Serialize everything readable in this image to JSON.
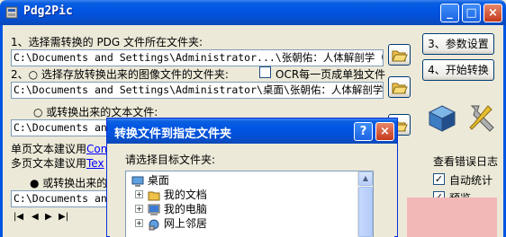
{
  "window": {
    "title": "Pdg2Pic",
    "minimize": "_",
    "maximize": "□",
    "close": "×"
  },
  "step1": {
    "label": "1、选择需转换的 PDG 文件所在文件夹:",
    "path": "C:\\Documents and Settings\\Administrator...\\张朝佑：人体解剖学（第二版）"
  },
  "step2": {
    "label": "2、○ 选择存放转换出来的图像文件的文件夹:",
    "ocr_label": "OCR每一页成单独文件",
    "path": "C:\\Documents and Settings\\Administrator\\桌面\\张朝佑：人体解剖学（第二"
  },
  "step3": {
    "label": "○ 或转换出来的文本文件:",
    "path": "C:\\Documents and Se",
    "single_text": "单页文本建议用",
    "single_link": "Com",
    "multi_text": "多页文本建议用",
    "multi_link": "Tex",
    "radio_label": "● 或转换出来的",
    "path2": "C:\\Documents and S"
  },
  "buttons": {
    "settings": "3、参数设置",
    "start": "4、开始转换"
  },
  "log": {
    "title": "查看错误日志",
    "auto_stats": "自动统计",
    "preview": "预览"
  },
  "dialog": {
    "title": "转换文件到指定文件夹",
    "help": "?",
    "close": "×",
    "prompt": "请选择目标文件夹:",
    "tree": [
      {
        "label": "桌面"
      },
      {
        "label": "我的文档"
      },
      {
        "label": "我的电脑"
      },
      {
        "label": "网上邻居"
      }
    ]
  },
  "media": {
    "buttons": [
      "|◀",
      "◀",
      "▶",
      "▶|"
    ]
  },
  "colors": {
    "titlebar": "#0054E3",
    "face": "#ECE9D8",
    "accent_pink": "#F2B8B8"
  }
}
